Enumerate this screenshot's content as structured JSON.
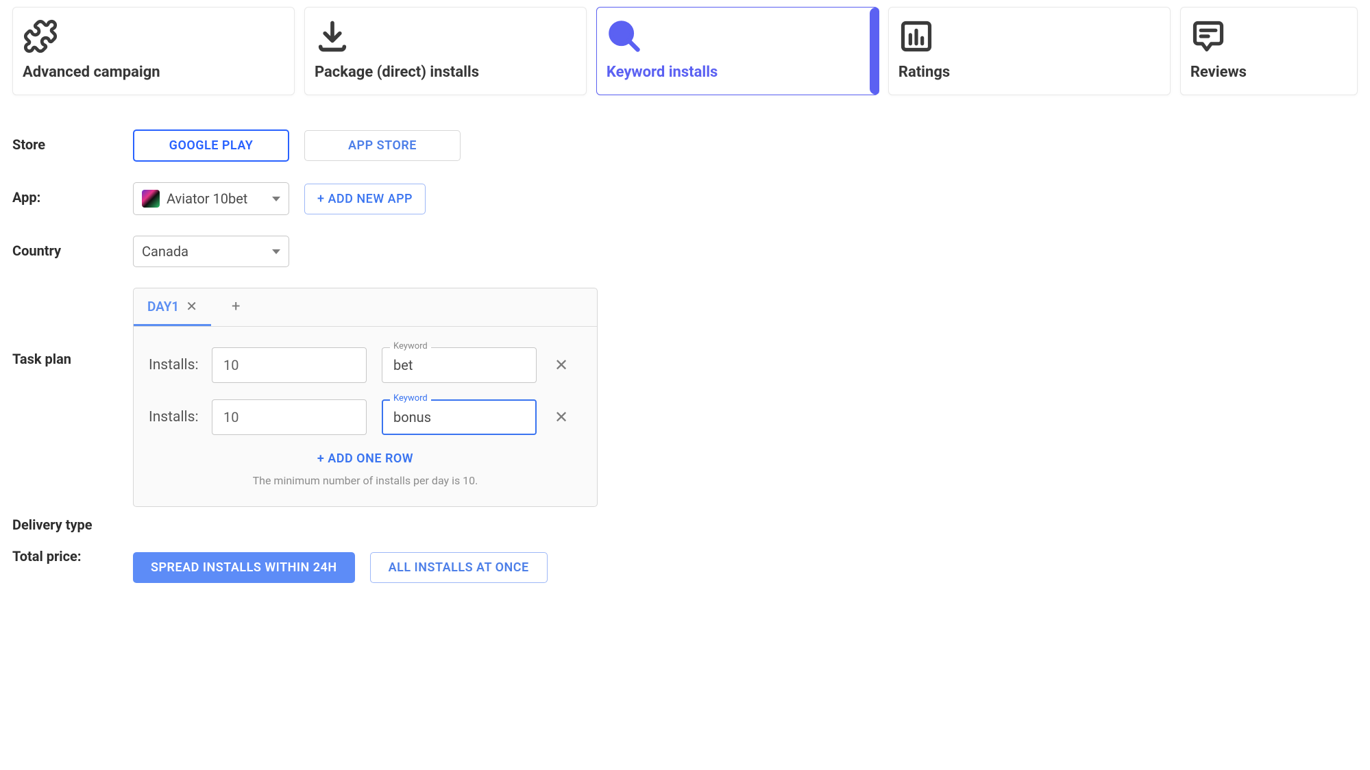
{
  "tabs": [
    {
      "label": "Advanced campaign"
    },
    {
      "label": "Package (direct) installs"
    },
    {
      "label": "Keyword installs"
    },
    {
      "label": "Ratings"
    },
    {
      "label": "Reviews"
    }
  ],
  "form": {
    "store_label": "Store",
    "store_options": {
      "google": "GOOGLE PLAY",
      "appstore": "APP STORE"
    },
    "app_label": "App:",
    "app_selected": "Aviator 10bet",
    "add_app": "+ ADD NEW APP",
    "country_label": "Country",
    "country_selected": "Canada",
    "task_plan_label": "Task plan",
    "delivery_label": "Delivery type",
    "total_label": "Total price:"
  },
  "plan": {
    "day_tab": "DAY1",
    "add_tab": "+",
    "rows": [
      {
        "installs_label": "Installs:",
        "installs": "10",
        "kw_label": "Keyword",
        "keyword": "bet"
      },
      {
        "installs_label": "Installs:",
        "installs": "10",
        "kw_label": "Keyword",
        "keyword": "bonus"
      }
    ],
    "add_row": "+ ADD ONE ROW",
    "hint": "The minimum number of installs per day is 10."
  },
  "delivery": {
    "spread": "SPREAD INSTALLS WITHIN 24H",
    "once": "ALL INSTALLS AT ONCE"
  }
}
